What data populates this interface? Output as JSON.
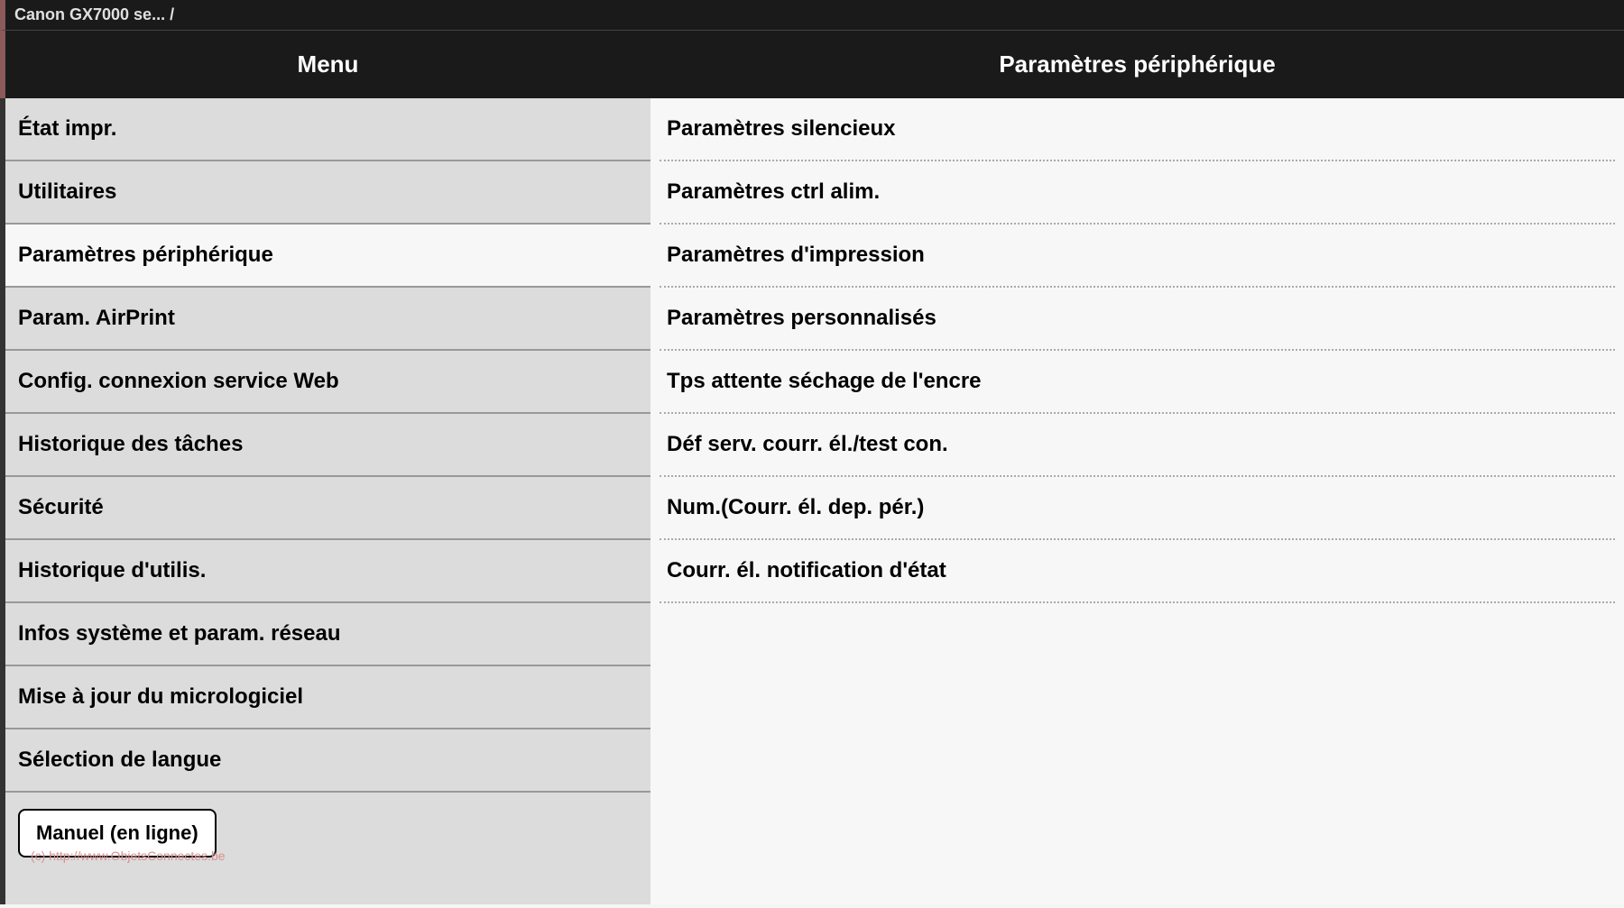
{
  "breadcrumb": "Canon GX7000 se... /",
  "header": {
    "menu_label": "Menu",
    "content_title": "Paramètres périphérique"
  },
  "sidebar": {
    "items": [
      {
        "id": "printer-status",
        "label": "État impr.",
        "active": false
      },
      {
        "id": "utilities",
        "label": "Utilitaires",
        "active": false
      },
      {
        "id": "device-settings",
        "label": "Paramètres périphérique",
        "active": true
      },
      {
        "id": "airprint-settings",
        "label": "Param. AirPrint",
        "active": false
      },
      {
        "id": "web-service-config",
        "label": "Config. connexion service Web",
        "active": false
      },
      {
        "id": "task-history",
        "label": "Historique des tâches",
        "active": false
      },
      {
        "id": "security",
        "label": "Sécurité",
        "active": false
      },
      {
        "id": "usage-history",
        "label": "Historique d'utilis.",
        "active": false
      },
      {
        "id": "system-info-network",
        "label": "Infos système et param. réseau",
        "active": false
      },
      {
        "id": "firmware-update",
        "label": "Mise à jour du micrologiciel",
        "active": false
      },
      {
        "id": "language-selection",
        "label": "Sélection de langue",
        "active": false
      }
    ],
    "manual_button_label": "Manuel (en ligne)"
  },
  "content": {
    "items": [
      {
        "id": "quiet-settings",
        "label": "Paramètres silencieux"
      },
      {
        "id": "power-ctrl-settings",
        "label": "Paramètres ctrl alim."
      },
      {
        "id": "print-settings",
        "label": "Paramètres d'impression"
      },
      {
        "id": "custom-settings",
        "label": "Paramètres personnalisés"
      },
      {
        "id": "ink-dry-wait-time",
        "label": "Tps attente séchage de l'encre"
      },
      {
        "id": "mail-server-test",
        "label": "Déf serv. courr. él./test con."
      },
      {
        "id": "scan-email-from-device",
        "label": "Num.(Courr. él. dep. pér.)"
      },
      {
        "id": "status-notification-email",
        "label": "Courr. él. notification d'état"
      }
    ]
  },
  "watermark": "(c) http://www.ObjetsConnectes.be"
}
